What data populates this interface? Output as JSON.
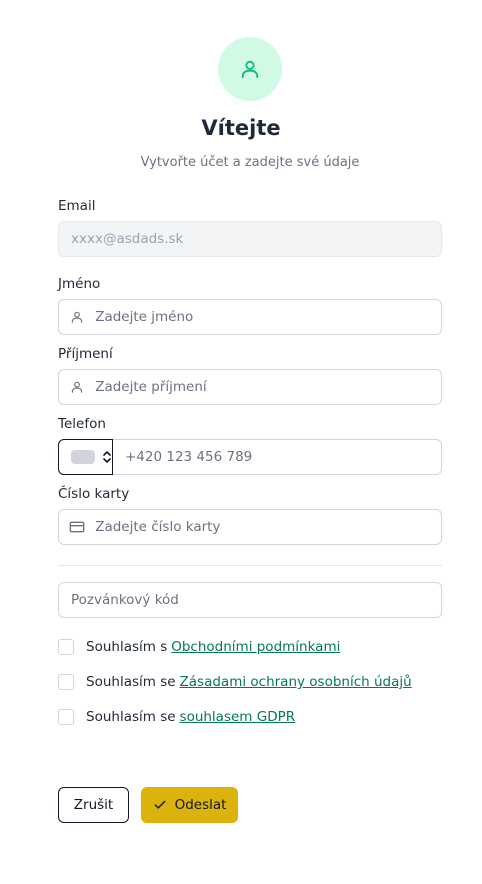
{
  "header": {
    "avatar_icon": "user-icon",
    "accent_color": "#10b981",
    "title": "Vítejte",
    "subtitle": "Vytvořte účet a zadejte své údaje"
  },
  "form": {
    "email": {
      "label": "Email",
      "placeholder": "xxxx@asdads.sk",
      "disabled": true
    },
    "first_name": {
      "label": "Jméno",
      "placeholder": "Zadejte jméno",
      "icon": "user-icon"
    },
    "last_name": {
      "label": "Příjmení",
      "placeholder": "Zadejte příjmení",
      "icon": "user-icon"
    },
    "phone": {
      "label": "Telefon",
      "placeholder": "+420 123 456 789",
      "country_icon": "chevron-updown-icon"
    },
    "card": {
      "label": "Číslo karty",
      "placeholder": "Zadejte číslo karty",
      "icon": "credit-card-icon"
    },
    "invite_code": {
      "placeholder": "Pozvánkový kód"
    }
  },
  "consents": [
    {
      "prefix": "Souhlasím s",
      "link": "Obchodními podmínkami"
    },
    {
      "prefix": "Souhlasím se",
      "link": "Zásadami ochrany osobních údajů"
    },
    {
      "prefix": "Souhlasím se",
      "link": "souhlasem GDPR"
    }
  ],
  "actions": {
    "cancel_label": "Zrušit",
    "submit_label": "Odeslat",
    "submit_color": "#dcb20c"
  }
}
